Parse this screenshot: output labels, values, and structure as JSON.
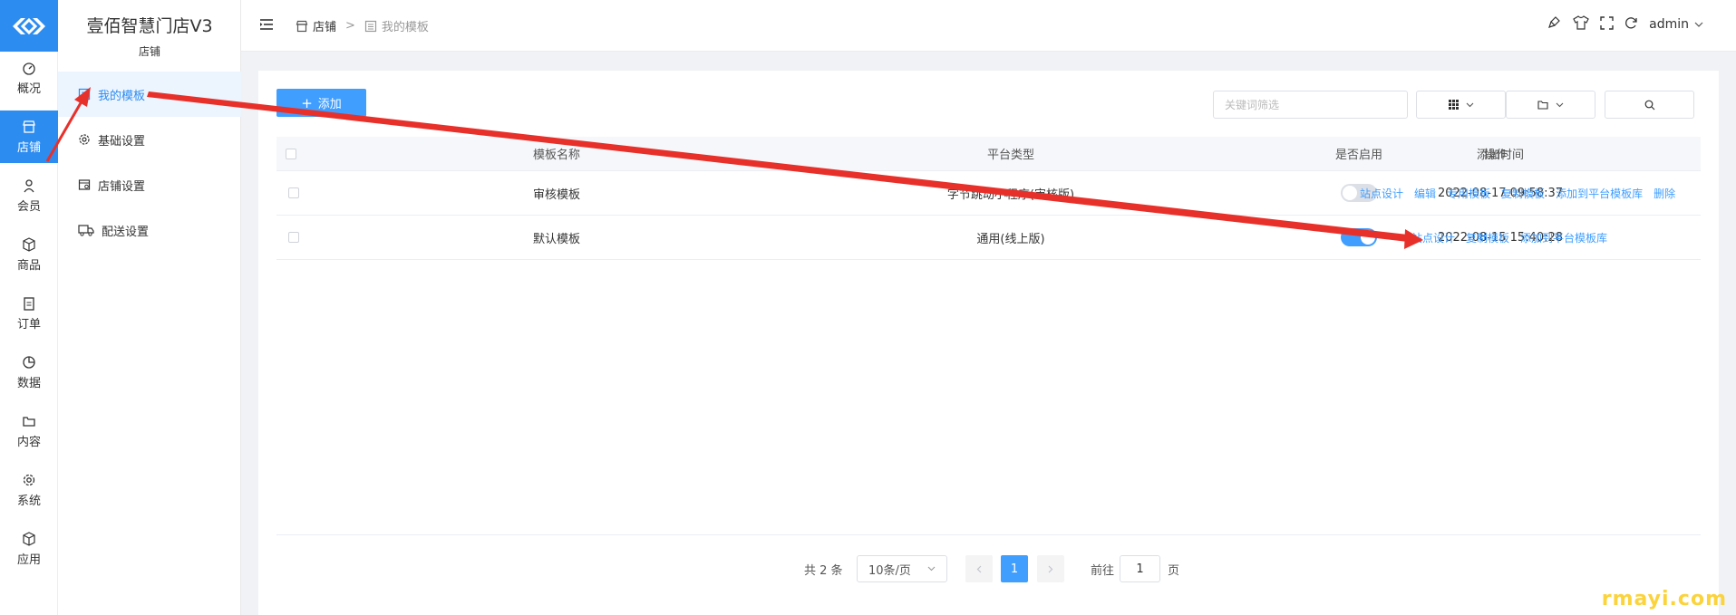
{
  "app": {
    "title": "壹佰智慧门店V3",
    "subtitle": "店铺"
  },
  "rail": [
    {
      "label": "概况",
      "icon": "dashboard-icon"
    },
    {
      "label": "店铺",
      "icon": "store-icon"
    },
    {
      "label": "会员",
      "icon": "user-icon"
    },
    {
      "label": "商品",
      "icon": "box-icon"
    },
    {
      "label": "订单",
      "icon": "clipboard-icon"
    },
    {
      "label": "数据",
      "icon": "pie-chart-icon"
    },
    {
      "label": "内容",
      "icon": "folder-icon"
    },
    {
      "label": "系统",
      "icon": "gear-icon"
    },
    {
      "label": "应用",
      "icon": "cube-icon"
    }
  ],
  "side_menu": [
    {
      "label": "我的模板",
      "icon": "template-icon"
    },
    {
      "label": "基础设置",
      "icon": "gear-icon"
    },
    {
      "label": "店铺设置",
      "icon": "shop-settings-icon"
    },
    {
      "label": "配送设置",
      "icon": "truck-icon"
    }
  ],
  "breadcrumb": {
    "parent": "店铺",
    "separator": ">",
    "current": "我的模板"
  },
  "header_right": {
    "user": "admin"
  },
  "toolbar": {
    "add_label": "添加",
    "search_placeholder": "关键词筛选"
  },
  "table": {
    "headers": {
      "name": "模板名称",
      "platform": "平台类型",
      "enabled": "是否启用",
      "time": "添加时间",
      "ops": "操作"
    },
    "rows": [
      {
        "name": "审核模板",
        "platform": "字节跳动小程序(审核版)",
        "enabled": false,
        "time": "2022-08-17 09:58:37",
        "ops": [
          "站点设计",
          "编辑",
          "专用模板",
          "复制模板",
          "添加到平台模板库",
          "删除"
        ]
      },
      {
        "name": "默认模板",
        "platform": "通用(线上版)",
        "enabled": true,
        "time": "2022-08-15 15:40:28",
        "ops": [
          "站点设计",
          "复制模板",
          "添加到平台模板库"
        ]
      }
    ]
  },
  "pagination": {
    "total": "共 2 条",
    "page_size": "10条/页",
    "current_page": "1",
    "goto_prefix": "前往",
    "goto_value": "1",
    "goto_suffix": "页"
  },
  "watermark": "rmayi.com",
  "colors": {
    "primary": "#409eff",
    "rail_active": "#2d8cf0",
    "annotation": "#e8302a"
  }
}
